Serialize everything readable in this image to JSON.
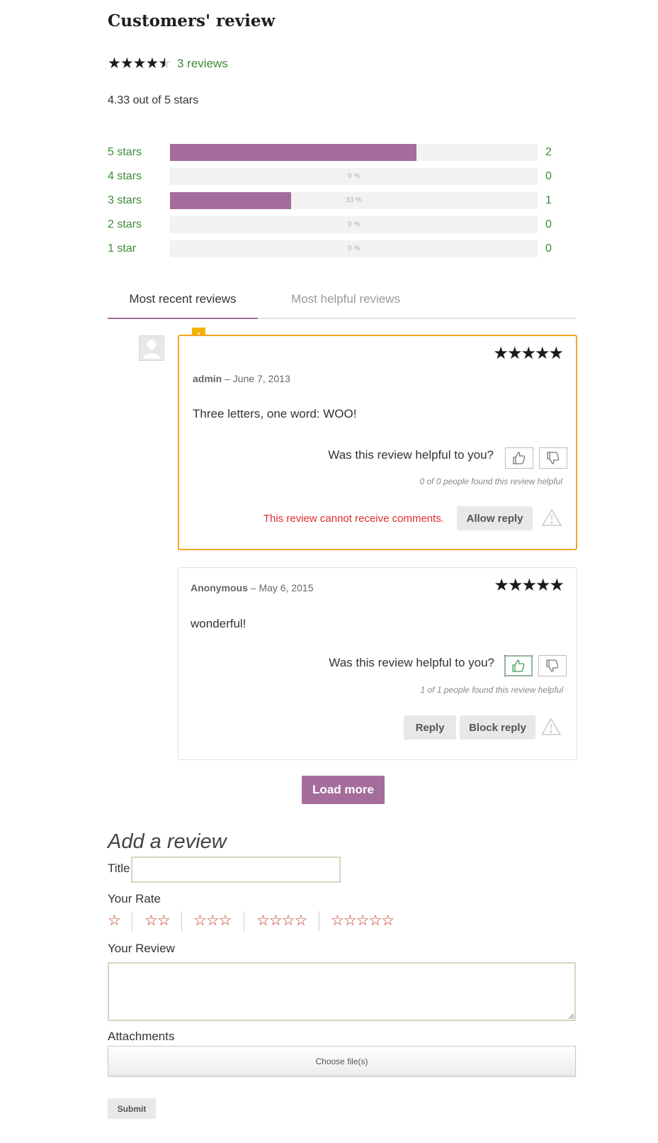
{
  "section_title": "Customers' review",
  "summary": {
    "average_rating": 4.33,
    "stars_display": 5,
    "reviews_link": "3 reviews",
    "average_text": "4.33 out of 5 stars"
  },
  "breakdown": [
    {
      "label": "5 stars",
      "count": "2",
      "percent": 67,
      "percent_label": ""
    },
    {
      "label": "4 stars",
      "count": "0",
      "percent": 0,
      "percent_label": "0 %"
    },
    {
      "label": "3 stars",
      "count": "1",
      "percent": 33,
      "percent_label": "33 %"
    },
    {
      "label": "2 stars",
      "count": "0",
      "percent": 0,
      "percent_label": "0 %"
    },
    {
      "label": "1 star",
      "count": "0",
      "percent": 0,
      "percent_label": "0 %"
    }
  ],
  "tabs": {
    "recent": "Most recent reviews",
    "helpful": "Most helpful reviews",
    "active": "recent"
  },
  "reviews": [
    {
      "author": "admin",
      "date": "– June 7, 2013",
      "rating": 5,
      "stars": "★★★★★",
      "text": "Three letters, one word: WOO!",
      "helpful_question": "Was this review helpful to you?",
      "helpful_note": "0 of 0 people found this review helpful",
      "notice": "This review cannot receive comments.",
      "action_label": "Allow reply",
      "featured": true
    },
    {
      "author": "Anonymous",
      "date": "– May 6, 2015",
      "rating": 5,
      "stars": "★★★★★",
      "text": "wonderful!",
      "helpful_question": "Was this review helpful to you?",
      "helpful_note": "1 of 1 people found this review helpful",
      "reply_label": "Reply",
      "action_label": "Block reply",
      "voted": "up"
    }
  ],
  "load_more_label": "Load more",
  "form": {
    "heading": "Add a review",
    "title_label": "Title",
    "title_value": "",
    "rate_label": "Your Rate",
    "rate_options": [
      "☆",
      "☆☆",
      "☆☆☆",
      "☆☆☆☆",
      "☆☆☆☆☆"
    ],
    "review_label": "Your Review",
    "review_value": "",
    "attachments_label": "Attachments",
    "choose_files_label": "Choose file(s)",
    "submit_label": "Submit"
  },
  "colors": {
    "accent": "#a46d9c",
    "link_green": "#3d8b37",
    "featured_border": "#f4a521",
    "warning_red": "#e02b2b",
    "rate_star": "#c0341d"
  },
  "icons": {
    "featured": "featured-ribbon-icon",
    "thumbs_up": "thumbs-up-icon",
    "thumbs_down": "thumbs-down-icon",
    "report": "warning-icon",
    "avatar": "avatar-placeholder-icon"
  }
}
